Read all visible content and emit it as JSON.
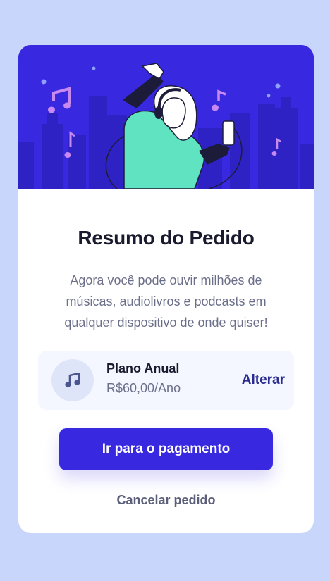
{
  "colors": {
    "page_background": "#c9d6fc",
    "accent": "#3829e0",
    "link": "#2a2d8f"
  },
  "card": {
    "hero": {
      "illustration": "woman-with-headphones-dancing-music-illustration"
    },
    "title": "Resumo do Pedido",
    "description": "Agora você pode ouvir milhões de músicas, audiolivros e podcasts em qualquer dispositivo de onde quiser!",
    "plan": {
      "icon": "music-note-icon",
      "name": "Plano Anual",
      "price": "R$60,00/Ano",
      "change_label": "Alterar"
    },
    "pay_button_label": "Ir para o pagamento",
    "cancel_label": "Cancelar pedido"
  }
}
